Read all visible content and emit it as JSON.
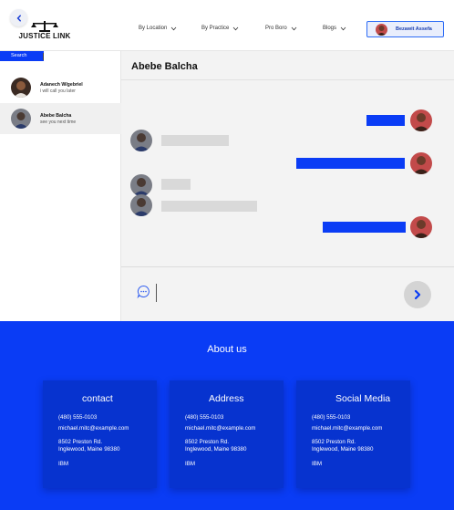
{
  "header": {
    "logo_text": "JUSTICE LINK",
    "nav": [
      {
        "label": "By Location"
      },
      {
        "label": "By Practice"
      },
      {
        "label": "Pro Boro"
      },
      {
        "label": "Blogs"
      }
    ],
    "user_name": "Bezawit Assefa"
  },
  "sidebar": {
    "search_label": "Search",
    "contacts": [
      {
        "name": "Adanech W/gebriel",
        "last_message": "i will call you later"
      },
      {
        "name": "Abebe Balcha",
        "last_message": "see you next time"
      }
    ]
  },
  "chat": {
    "title": "Abebe Balcha",
    "messages": [
      {
        "direction": "outgoing"
      },
      {
        "direction": "incoming"
      },
      {
        "direction": "outgoing"
      },
      {
        "direction": "incoming"
      },
      {
        "direction": "incoming"
      },
      {
        "direction": "outgoing"
      }
    ]
  },
  "footer": {
    "about_title": "About us",
    "cards": [
      {
        "title": "contact",
        "phone": "(480) 555-0103",
        "email": "michael.mitc@example.com",
        "address_line1": "8502 Preston Rd.",
        "address_line2": "Inglewood, Maine 98380",
        "company": "IBM"
      },
      {
        "title": "Address",
        "phone": "(480) 555-0103",
        "email": "michael.mitc@example.com",
        "address_line1": "8502 Preston Rd.",
        "address_line2": "Inglewood, Maine 98380",
        "company": "IBM"
      },
      {
        "title": "Social Media",
        "phone": "(480) 555-0103",
        "email": "michael.mitc@example.com",
        "address_line1": "8502 Preston Rd.",
        "address_line2": "Inglewood, Maine 98380",
        "company": "IBM"
      }
    ]
  },
  "colors": {
    "accent": "#0a3cf5",
    "card": "#0733cf",
    "panel_bg": "#f3f3f3"
  }
}
